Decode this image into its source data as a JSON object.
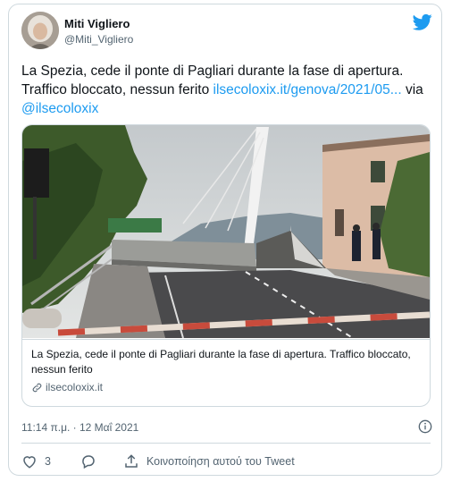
{
  "tweet": {
    "author_name": "Miti Vigliero",
    "author_handle": "@Miti_Vigliero",
    "text_main": "La Spezia, cede il ponte di Pagliari durante la fase di apertura. Traffico bloccato, nessun ferito",
    "link_url": "ilsecoloxix.it/genova/2021/05...",
    "text_via": "via",
    "via_mention": "@ilsecoloxix",
    "link_card": {
      "title": "La Spezia, cede il ponte di Pagliari durante la fase di apertura. Traffico bloccato, nessun ferito",
      "domain": "ilsecoloxix.it"
    },
    "timestamp": "11:14 π.μ. · 12 Μαΐ 2021",
    "like_count": "3",
    "share_label": "Κοινοποίηση αυτού του Tweet"
  },
  "icons": {
    "brand": "twitter-bird-icon",
    "info": "info-icon",
    "like": "heart-icon",
    "reply": "reply-bubble-icon",
    "share": "share-icon",
    "link": "link-icon"
  },
  "colors": {
    "brand_blue": "#1d9bf0",
    "text": "#0f1419",
    "secondary": "#536471",
    "border": "#cfd9de"
  }
}
